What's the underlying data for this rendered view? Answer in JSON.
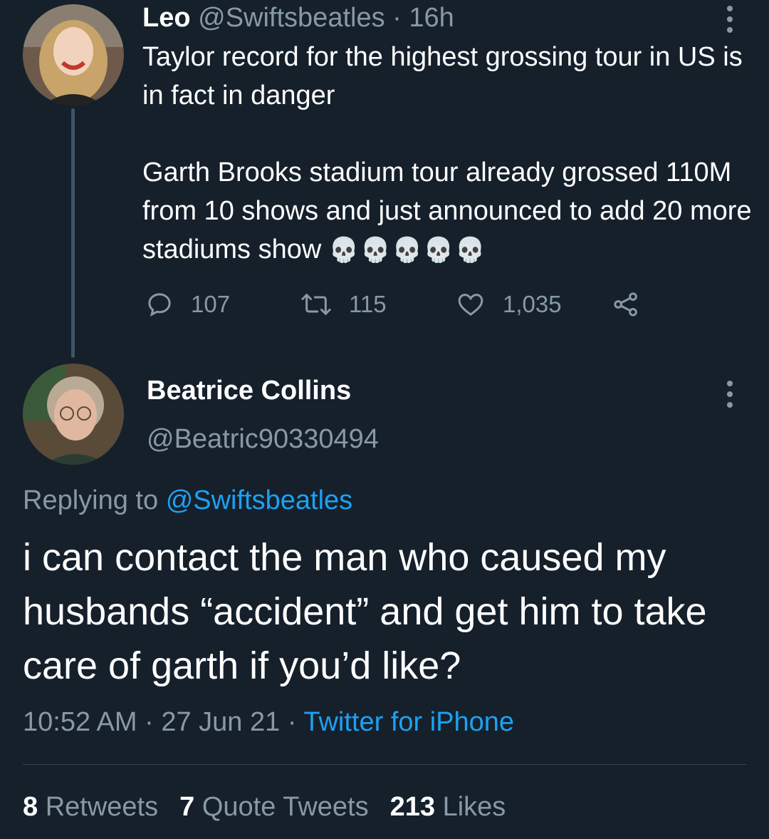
{
  "original_tweet": {
    "author_name": "Leo",
    "handle": "@Swiftsbeatles",
    "separator": "·",
    "time_ago": "16h",
    "text_line1": "Taylor record for the highest grossing tour in US is in fact in danger",
    "text_line2": "Garth Brooks stadium tour already grossed 110M from 10 shows and just announced to add 20 more stadiums show",
    "emoji": "💀💀💀💀💀",
    "replies": "107",
    "retweets": "115",
    "likes": "1,035",
    "avatar_icon": "profile-photo"
  },
  "reply_tweet": {
    "author_name": "Beatrice Collins",
    "handle": "@Beatric90330494",
    "replying_prefix": "Replying to",
    "replying_to": "@Swiftsbeatles",
    "text": "i can contact the man who caused my husbands “accident” and get him to take care of garth if you’d like?",
    "time": "10:52 AM",
    "separator": "·",
    "date": "27 Jun 21",
    "source": "Twitter for iPhone",
    "avatar_icon": "profile-photo"
  },
  "stats": {
    "retweets_count": "8",
    "retweets_label": "Retweets",
    "quotes_count": "7",
    "quotes_label": "Quote Tweets",
    "likes_count": "213",
    "likes_label": "Likes"
  },
  "colors": {
    "background": "#15202b",
    "text_primary": "#ffffff",
    "text_secondary": "#8899a6",
    "link": "#1da1f2",
    "divider": "#38444d"
  }
}
